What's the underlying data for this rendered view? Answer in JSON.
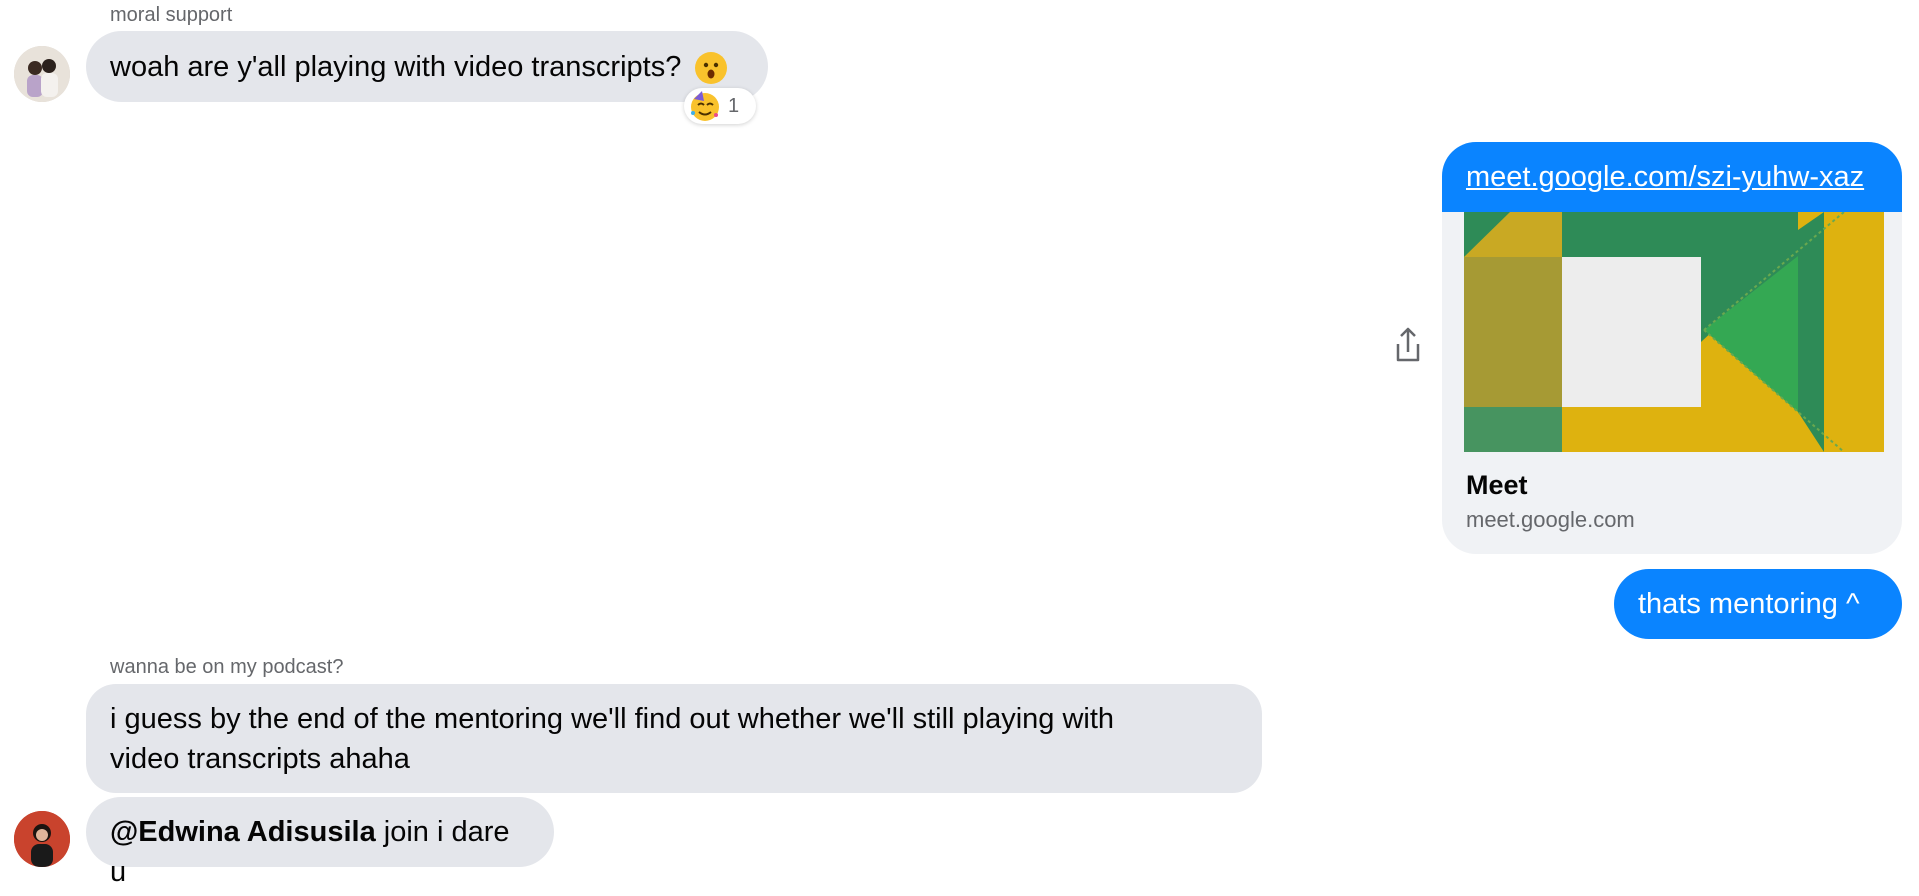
{
  "messages": {
    "m1": {
      "sender": "moral support",
      "text": "woah are y'all playing with video transcripts?",
      "reaction_count": "1"
    },
    "m2": {
      "link_url": "meet.google.com/szi-yuhw-xaz",
      "link_title": "Meet",
      "link_domain": "meet.google.com"
    },
    "m3": {
      "text": "thats mentoring ^"
    },
    "m4": {
      "sender": "wanna be on my podcast?",
      "text_line1": "i guess by the end of the mentoring we'll find out whether we'll still playing with",
      "text_line2": "video transcripts ahaha"
    },
    "m5": {
      "mention": "@Edwina Adisusila",
      "text": " join i dare u"
    }
  },
  "icons": {
    "share": "share-icon",
    "reaction_emoji": "partying-face-icon",
    "message_emoji": "astonished-face-icon"
  },
  "colors": {
    "outgoing_bubble": "#0a84ff",
    "incoming_bubble": "#e4e6eb",
    "meet_green": "#2e8b57",
    "meet_yellow": "#deb20f"
  }
}
